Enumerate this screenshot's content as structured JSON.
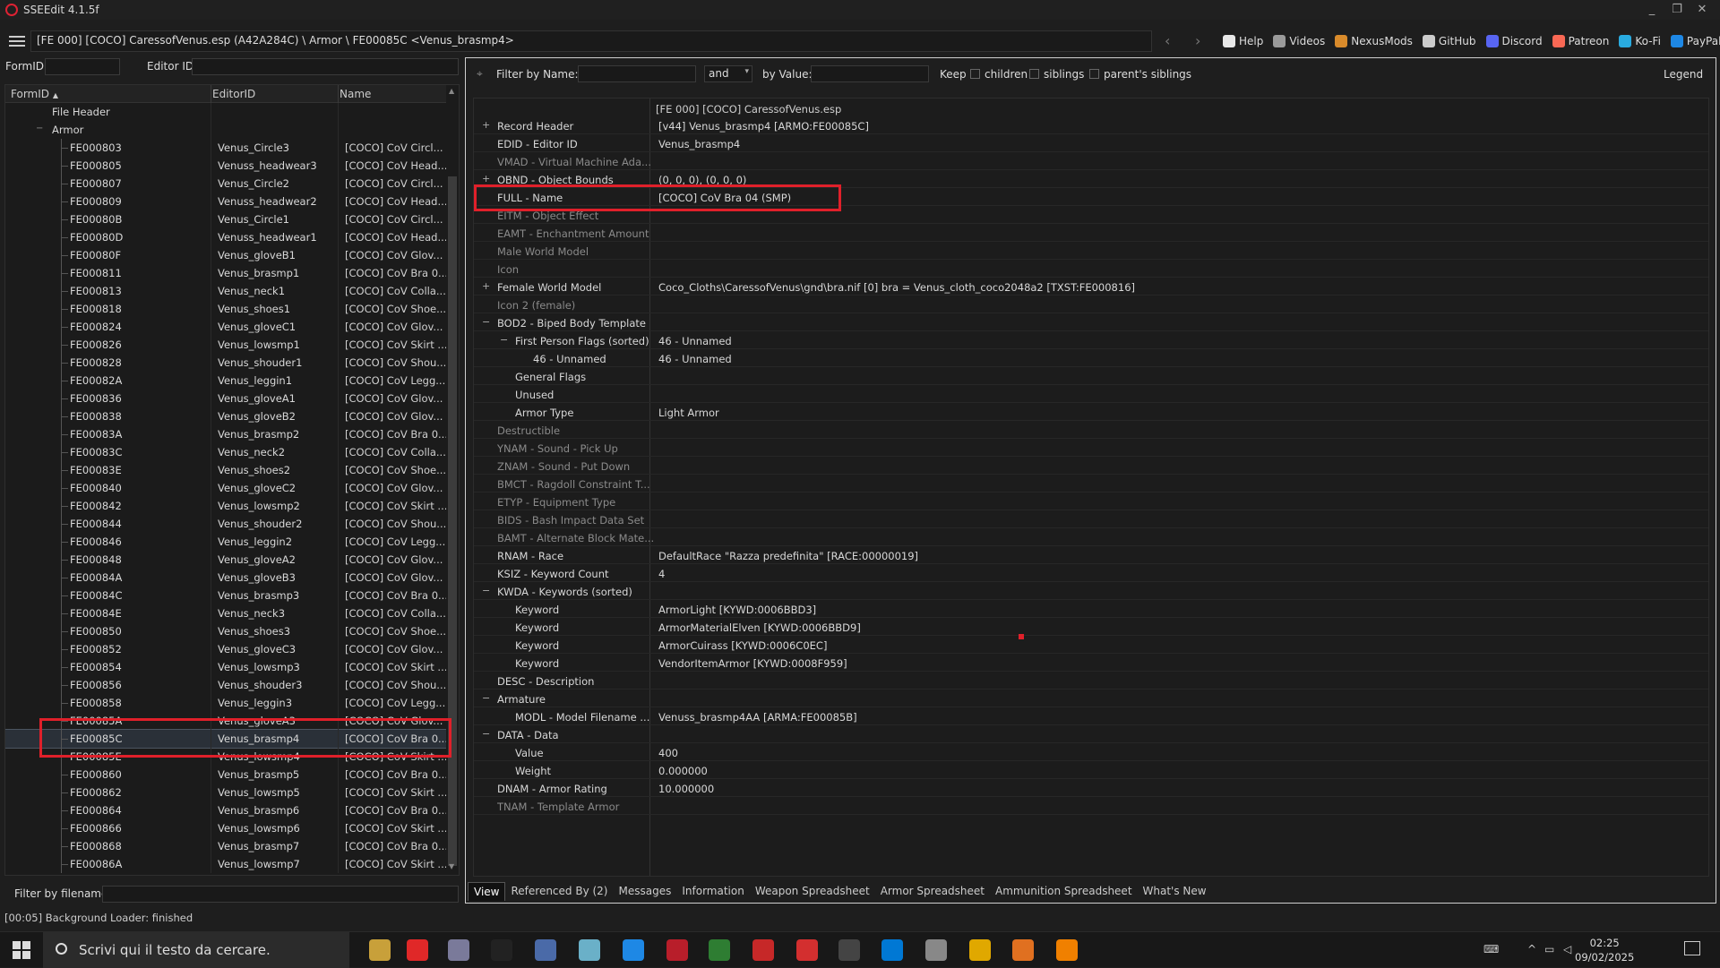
{
  "titlebar": {
    "title": "SSEEdit 4.1.5f",
    "minimize": "_",
    "restore": "❐",
    "close": "✕"
  },
  "menubar": {
    "path": "[FE 000] [COCO] CaressofVenus.esp (A42A284C) \\ Armor \\ FE00085C <Venus_brasmp4>",
    "back": "‹",
    "forward": "›",
    "links": [
      {
        "label": "Help",
        "color": "#e8e8e8"
      },
      {
        "label": "Videos",
        "color": "#9a9a9a"
      },
      {
        "label": "NexusMods",
        "color": "#d98b2b"
      },
      {
        "label": "GitHub",
        "color": "#cccccc"
      },
      {
        "label": "Discord",
        "color": "#5865f2"
      },
      {
        "label": "Patreon",
        "color": "#f96854"
      },
      {
        "label": "Ko-Fi",
        "color": "#29abe0"
      },
      {
        "label": "PayPal",
        "color": "#1e88e5"
      }
    ]
  },
  "left_filters": {
    "formid_label": "FormID",
    "editorid_label": "Editor ID"
  },
  "left_tree": {
    "col_formid": "FormID",
    "col_editorid": "EditorID",
    "col_name": "Name",
    "sort_indicator": "▲",
    "file_header": "File Header",
    "group": "Armor",
    "rows": [
      [
        "FE000803",
        "Venus_Circle3",
        "[COCO] CoV Circl..."
      ],
      [
        "FE000805",
        "Venuss_headwear3",
        "[COCO] CoV Head..."
      ],
      [
        "FE000807",
        "Venus_Circle2",
        "[COCO] CoV Circl..."
      ],
      [
        "FE000809",
        "Venuss_headwear2",
        "[COCO] CoV Head..."
      ],
      [
        "FE00080B",
        "Venus_Circle1",
        "[COCO] CoV Circl..."
      ],
      [
        "FE00080D",
        "Venuss_headwear1",
        "[COCO] CoV Head..."
      ],
      [
        "FE00080F",
        "Venus_gloveB1",
        "[COCO] CoV Glov..."
      ],
      [
        "FE000811",
        "Venus_brasmp1",
        "[COCO] CoV Bra 0..."
      ],
      [
        "FE000813",
        "Venus_neck1",
        "[COCO] CoV Colla..."
      ],
      [
        "FE000818",
        "Venus_shoes1",
        "[COCO] CoV Shoe..."
      ],
      [
        "FE000824",
        "Venus_gloveC1",
        "[COCO] CoV Glov..."
      ],
      [
        "FE000826",
        "Venus_lowsmp1",
        "[COCO] CoV Skirt ..."
      ],
      [
        "FE000828",
        "Venus_shouder1",
        "[COCO] CoV Shou..."
      ],
      [
        "FE00082A",
        "Venus_leggin1",
        "[COCO] CoV Legg..."
      ],
      [
        "FE000836",
        "Venus_gloveA1",
        "[COCO] CoV Glov..."
      ],
      [
        "FE000838",
        "Venus_gloveB2",
        "[COCO] CoV Glov..."
      ],
      [
        "FE00083A",
        "Venus_brasmp2",
        "[COCO] CoV Bra 0..."
      ],
      [
        "FE00083C",
        "Venus_neck2",
        "[COCO] CoV Colla..."
      ],
      [
        "FE00083E",
        "Venus_shoes2",
        "[COCO] CoV Shoe..."
      ],
      [
        "FE000840",
        "Venus_gloveC2",
        "[COCO] CoV Glov..."
      ],
      [
        "FE000842",
        "Venus_lowsmp2",
        "[COCO] CoV Skirt ..."
      ],
      [
        "FE000844",
        "Venus_shouder2",
        "[COCO] CoV Shou..."
      ],
      [
        "FE000846",
        "Venus_leggin2",
        "[COCO] CoV Legg..."
      ],
      [
        "FE000848",
        "Venus_gloveA2",
        "[COCO] CoV Glov..."
      ],
      [
        "FE00084A",
        "Venus_gloveB3",
        "[COCO] CoV Glov..."
      ],
      [
        "FE00084C",
        "Venus_brasmp3",
        "[COCO] CoV Bra 0..."
      ],
      [
        "FE00084E",
        "Venus_neck3",
        "[COCO] CoV Colla..."
      ],
      [
        "FE000850",
        "Venus_shoes3",
        "[COCO] CoV Shoe..."
      ],
      [
        "FE000852",
        "Venus_gloveC3",
        "[COCO] CoV Glov..."
      ],
      [
        "FE000854",
        "Venus_lowsmp3",
        "[COCO] CoV Skirt ..."
      ],
      [
        "FE000856",
        "Venus_shouder3",
        "[COCO] CoV Shou..."
      ],
      [
        "FE000858",
        "Venus_leggin3",
        "[COCO] CoV Legg..."
      ],
      [
        "FE00085A",
        "Venus_gloveA3",
        "[COCO] CoV Glov..."
      ],
      [
        "FE00085C",
        "Venus_brasmp4",
        "[COCO] CoV Bra 0..."
      ],
      [
        "FE00085E",
        "Venus_lowsmp4",
        "[COCO] CoV Skirt ..."
      ],
      [
        "FE000860",
        "Venus_brasmp5",
        "[COCO] CoV Bra 0..."
      ],
      [
        "FE000862",
        "Venus_lowsmp5",
        "[COCO] CoV Skirt ..."
      ],
      [
        "FE000864",
        "Venus_brasmp6",
        "[COCO] CoV Bra 0..."
      ],
      [
        "FE000866",
        "Venus_lowsmp6",
        "[COCO] CoV Skirt ..."
      ],
      [
        "FE000868",
        "Venus_brasmp7",
        "[COCO] CoV Bra 0..."
      ],
      [
        "FE00086A",
        "Venus_lowsmp7",
        "[COCO] CoV Skirt ..."
      ]
    ],
    "selected_formid": "FE00085C"
  },
  "left_bottom": {
    "filter_by_filename": "Filter by filename:"
  },
  "status": "[00:05] Background Loader: finished",
  "right_filter": {
    "filter_by_name": "Filter by Name:",
    "op": "and",
    "by_value": "by Value:",
    "keep": "Keep",
    "children": "children",
    "siblings": "siblings",
    "parents_siblings": "parent's siblings",
    "legend": "Legend"
  },
  "record": {
    "file_header": "[FE 000] [COCO] CaressofVenus.esp",
    "rows": [
      {
        "k": "Record Header",
        "v": "[v44] Venus_brasmp4 [ARMO:FE00085C]",
        "indent": 0,
        "exp": "+",
        "dim": false
      },
      {
        "k": "EDID - Editor ID",
        "v": "Venus_brasmp4",
        "indent": 0,
        "exp": "",
        "dim": false
      },
      {
        "k": "VMAD - Virtual Machine Ada...",
        "v": "",
        "indent": 0,
        "exp": "",
        "dim": true
      },
      {
        "k": "OBND - Object Bounds",
        "v": "(0, 0, 0), (0, 0, 0)",
        "indent": 0,
        "exp": "+",
        "dim": false
      },
      {
        "k": "FULL - Name",
        "v": "[COCO] CoV Bra 04 (SMP)",
        "indent": 0,
        "exp": "",
        "dim": false
      },
      {
        "k": "EITM - Object Effect",
        "v": "",
        "indent": 0,
        "exp": "",
        "dim": true
      },
      {
        "k": "EAMT - Enchantment Amount",
        "v": "",
        "indent": 0,
        "exp": "",
        "dim": true
      },
      {
        "k": "Male World Model",
        "v": "",
        "indent": 0,
        "exp": "",
        "dim": true
      },
      {
        "k": "Icon",
        "v": "",
        "indent": 0,
        "exp": "",
        "dim": true
      },
      {
        "k": "Female World Model",
        "v": "Coco_Cloths\\CaressofVenus\\gnd\\bra.nif [0] bra = Venus_cloth_coco2048a2 [TXST:FE000816]",
        "indent": 0,
        "exp": "+",
        "dim": false
      },
      {
        "k": "Icon 2 (female)",
        "v": "",
        "indent": 0,
        "exp": "",
        "dim": true
      },
      {
        "k": "BOD2 - Biped Body Template",
        "v": "",
        "indent": 0,
        "exp": "−",
        "dim": false
      },
      {
        "k": "First Person Flags (sorted)",
        "v": "46 - Unnamed",
        "indent": 1,
        "exp": "−",
        "dim": false
      },
      {
        "k": "46 - Unnamed",
        "v": "46 - Unnamed",
        "indent": 2,
        "exp": "",
        "dim": false
      },
      {
        "k": "General Flags",
        "v": "",
        "indent": 1,
        "exp": "",
        "dim": false
      },
      {
        "k": "Unused",
        "v": "",
        "indent": 1,
        "exp": "",
        "dim": false
      },
      {
        "k": "Armor Type",
        "v": "Light Armor",
        "indent": 1,
        "exp": "",
        "dim": false
      },
      {
        "k": "Destructible",
        "v": "",
        "indent": 0,
        "exp": "",
        "dim": true
      },
      {
        "k": "YNAM - Sound - Pick Up",
        "v": "",
        "indent": 0,
        "exp": "",
        "dim": true
      },
      {
        "k": "ZNAM - Sound - Put Down",
        "v": "",
        "indent": 0,
        "exp": "",
        "dim": true
      },
      {
        "k": "BMCT - Ragdoll Constraint T...",
        "v": "",
        "indent": 0,
        "exp": "",
        "dim": true
      },
      {
        "k": "ETYP - Equipment Type",
        "v": "",
        "indent": 0,
        "exp": "",
        "dim": true
      },
      {
        "k": "BIDS - Bash Impact Data Set",
        "v": "",
        "indent": 0,
        "exp": "",
        "dim": true
      },
      {
        "k": "BAMT - Alternate Block Mate...",
        "v": "",
        "indent": 0,
        "exp": "",
        "dim": true
      },
      {
        "k": "RNAM - Race",
        "v": "DefaultRace \"Razza predefinita\" [RACE:00000019]",
        "indent": 0,
        "exp": "",
        "dim": false
      },
      {
        "k": "KSIZ - Keyword Count",
        "v": "4",
        "indent": 0,
        "exp": "",
        "dim": false
      },
      {
        "k": "KWDA - Keywords (sorted)",
        "v": "",
        "indent": 0,
        "exp": "−",
        "dim": false
      },
      {
        "k": "Keyword",
        "v": "ArmorLight [KYWD:0006BBD3]",
        "indent": 1,
        "exp": "",
        "dim": false
      },
      {
        "k": "Keyword",
        "v": "ArmorMaterialElven [KYWD:0006BBD9]",
        "indent": 1,
        "exp": "",
        "dim": false
      },
      {
        "k": "Keyword",
        "v": "ArmorCuirass [KYWD:0006C0EC]",
        "indent": 1,
        "exp": "",
        "dim": false
      },
      {
        "k": "Keyword",
        "v": "VendorItemArmor [KYWD:0008F959]",
        "indent": 1,
        "exp": "",
        "dim": false
      },
      {
        "k": "DESC - Description",
        "v": "",
        "indent": 0,
        "exp": "",
        "dim": false
      },
      {
        "k": "Armature",
        "v": "",
        "indent": 0,
        "exp": "−",
        "dim": false
      },
      {
        "k": "MODL - Model Filename ...",
        "v": "Venuss_brasmp4AA [ARMA:FE00085B]",
        "indent": 1,
        "exp": "",
        "dim": false
      },
      {
        "k": "DATA - Data",
        "v": "",
        "indent": 0,
        "exp": "−",
        "dim": false
      },
      {
        "k": "Value",
        "v": "400",
        "indent": 1,
        "exp": "",
        "dim": false
      },
      {
        "k": "Weight",
        "v": "0.000000",
        "indent": 1,
        "exp": "",
        "dim": false
      },
      {
        "k": "DNAM - Armor Rating",
        "v": "10.000000",
        "indent": 0,
        "exp": "",
        "dim": false
      },
      {
        "k": "TNAM - Template Armor",
        "v": "",
        "indent": 0,
        "exp": "",
        "dim": true
      }
    ]
  },
  "tabs": [
    "View",
    "Referenced By (2)",
    "Messages",
    "Information",
    "Weapon Spreadsheet",
    "Armor Spreadsheet",
    "Ammunition Spreadsheet",
    "What's New"
  ],
  "taskbar": {
    "search_placeholder": "Scrivi qui il testo da cercare.",
    "time": "02:25",
    "date": "09/02/2025",
    "apps": [
      "#c8a03a",
      "#e02828",
      "#7a7a9a",
      "#222222",
      "#4a6aa8",
      "#6ab0c8",
      "#1e88e5",
      "#b81e2a",
      "#2e7d32",
      "#c62828",
      "#d32f2f",
      "#444444",
      "#0078d4",
      "#888888",
      "#e0a800",
      "#e07020",
      "#f08000"
    ]
  }
}
